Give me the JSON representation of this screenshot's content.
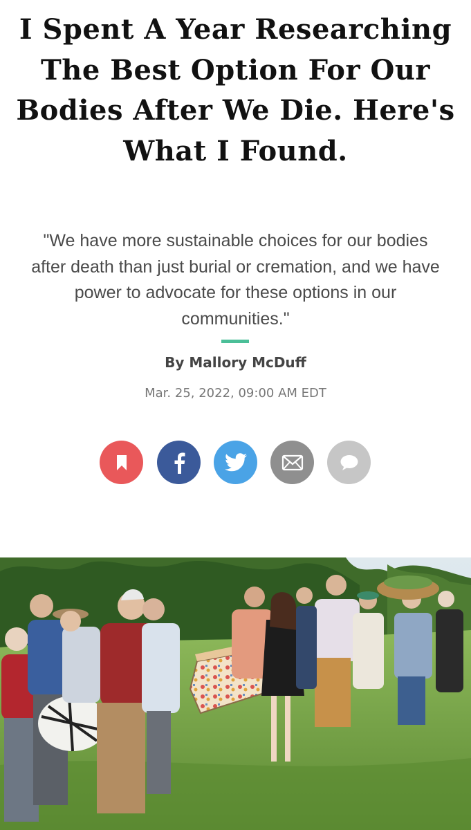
{
  "article": {
    "headline": "I Spent A Year Researching The Best Option For Our Bodies After We Die. Here's What I Found.",
    "dek": "\"We have more sustainable choices for our bodies after death than just burial or cremation, and we have power to advocate for these options in our communities.\"",
    "byline": "By Mallory McDuff",
    "date": "Mar. 25, 2022, 09:00 AM EDT"
  },
  "colors": {
    "accent_divider": "#4bbf98",
    "bookmark": "#e9585a",
    "facebook": "#3b5a9a",
    "twitter": "#4aa3e6",
    "email": "#8f8f8f",
    "comment": "#c6c6c6"
  },
  "share": {
    "buttons": [
      {
        "icon": "bookmark-icon"
      },
      {
        "icon": "facebook-icon"
      },
      {
        "icon": "twitter-icon"
      },
      {
        "icon": "email-icon"
      },
      {
        "icon": "comment-icon"
      }
    ]
  },
  "photo": {
    "subject": "People carrying a decorated casket and a wrapped shroud across a grassy field"
  }
}
